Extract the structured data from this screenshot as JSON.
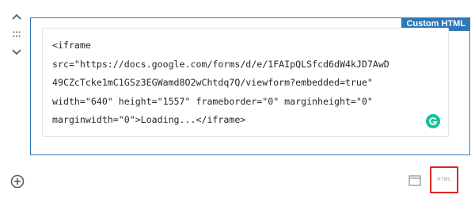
{
  "block": {
    "type_label": "Custom HTML",
    "code_lines": [
      "<iframe",
      "src=\"https://docs.google.com/forms/d/e/1FAIpQLSfcd6dW4kJD7AwD",
      "49CZcTcke1mC1GSz3EGWamd8O2wChtdq7Q/viewform?embedded=true\"",
      "width=\"640\" height=\"1557\" frameborder=\"0\" marginheight=\"0\"",
      "marginwidth=\"0\">Loading...</iframe>"
    ]
  },
  "toolbar": {
    "html_label": "HTML"
  },
  "icons": {
    "move_up": "chevron-up-icon",
    "drag": "drag-handle-icon",
    "move_down": "chevron-down-icon",
    "grammarly": "grammarly-icon",
    "add_block": "plus-circle-icon",
    "preview": "preview-icon"
  },
  "colors": {
    "accent": "#2e78b6",
    "highlight_box": "#e02424",
    "grammarly": "#15c39a"
  }
}
